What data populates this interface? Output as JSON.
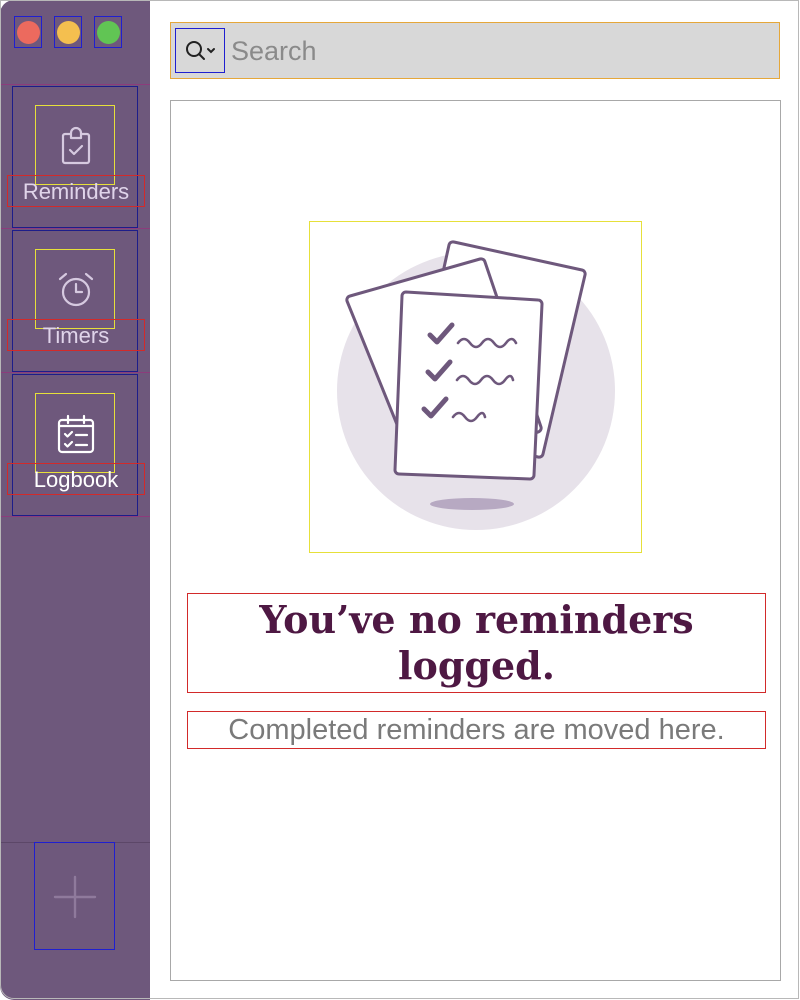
{
  "window": {
    "traffic_lights": [
      {
        "name": "close",
        "color": "#ec6a5e"
      },
      {
        "name": "minimize",
        "color": "#f4bf4f"
      },
      {
        "name": "zoom",
        "color": "#61c554"
      }
    ]
  },
  "sidebar": {
    "background": "#6e587c",
    "items": [
      {
        "label": "Reminders",
        "icon": "clipboard-check-icon",
        "active": false
      },
      {
        "label": "Timers",
        "icon": "alarm-clock-icon",
        "active": false
      },
      {
        "label": "Logbook",
        "icon": "calendar-checklist-icon",
        "active": true
      }
    ],
    "add_icon": "plus-icon"
  },
  "search": {
    "placeholder": "Search",
    "value": "",
    "scope_icon": "magnifier-dropdown-icon"
  },
  "empty_state": {
    "illustration": "checklist-papers-illustration",
    "title": "You’ve no reminders logged.",
    "subtitle": "Completed reminders are moved here.",
    "title_color": "#4e1843",
    "accent_color": "#6e587c"
  }
}
